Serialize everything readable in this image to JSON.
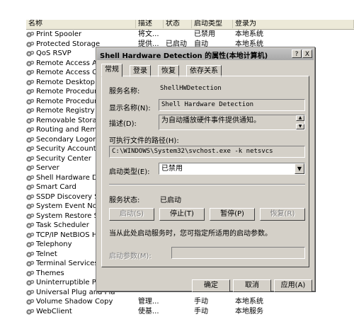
{
  "list": {
    "columns": [
      "名称",
      "描述",
      "状态",
      "启动类型",
      "登录为"
    ],
    "rows": [
      {
        "name": "Print Spooler",
        "desc": "将文...",
        "status": "",
        "startup": "已禁用",
        "logon": "本地系统"
      },
      {
        "name": "Protected Storage",
        "desc": "提供...",
        "status": "已启动",
        "startup": "自动",
        "logon": "本地系统"
      },
      {
        "name": "QoS RSVP",
        "desc": "",
        "status": "",
        "startup": "",
        "logon": ""
      },
      {
        "name": "Remote Access Auto C",
        "desc": "",
        "status": "",
        "startup": "",
        "logon": ""
      },
      {
        "name": "Remote Access Conne",
        "desc": "",
        "status": "",
        "startup": "",
        "logon": ""
      },
      {
        "name": "Remote Desktop Help",
        "desc": "",
        "status": "",
        "startup": "",
        "logon": ""
      },
      {
        "name": "Remote Procedure Ca",
        "desc": "",
        "status": "",
        "startup": "",
        "logon": ""
      },
      {
        "name": "Remote Procedure Ca",
        "desc": "",
        "status": "",
        "startup": "",
        "logon": ""
      },
      {
        "name": "Remote Registry",
        "desc": "",
        "status": "",
        "startup": "",
        "logon": ""
      },
      {
        "name": "Removable Storage",
        "desc": "",
        "status": "",
        "startup": "",
        "logon": ""
      },
      {
        "name": "Routing and Remote A",
        "desc": "",
        "status": "",
        "startup": "",
        "logon": ""
      },
      {
        "name": "Secondary Logon",
        "desc": "",
        "status": "",
        "startup": "",
        "logon": ""
      },
      {
        "name": "Security Accounts Mar",
        "desc": "",
        "status": "",
        "startup": "",
        "logon": ""
      },
      {
        "name": "Security Center",
        "desc": "",
        "status": "",
        "startup": "",
        "logon": ""
      },
      {
        "name": "Server",
        "desc": "",
        "status": "",
        "startup": "",
        "logon": ""
      },
      {
        "name": "Shell Hardware Detect",
        "desc": "",
        "status": "",
        "startup": "",
        "logon": ""
      },
      {
        "name": "Smart Card",
        "desc": "",
        "status": "",
        "startup": "",
        "logon": ""
      },
      {
        "name": "SSDP Discovery Servi",
        "desc": "",
        "status": "",
        "startup": "",
        "logon": ""
      },
      {
        "name": "System Event Notifica",
        "desc": "",
        "status": "",
        "startup": "",
        "logon": ""
      },
      {
        "name": "System Restore Servic",
        "desc": "",
        "status": "",
        "startup": "",
        "logon": ""
      },
      {
        "name": "Task Scheduler",
        "desc": "",
        "status": "",
        "startup": "",
        "logon": ""
      },
      {
        "name": "TCP/IP NetBIOS Helpe",
        "desc": "",
        "status": "",
        "startup": "",
        "logon": ""
      },
      {
        "name": "Telephony",
        "desc": "",
        "status": "",
        "startup": "",
        "logon": ""
      },
      {
        "name": "Telnet",
        "desc": "",
        "status": "",
        "startup": "",
        "logon": ""
      },
      {
        "name": "Terminal Services",
        "desc": "",
        "status": "",
        "startup": "",
        "logon": ""
      },
      {
        "name": "Themes",
        "desc": "",
        "status": "",
        "startup": "",
        "logon": ""
      },
      {
        "name": "Uninterruptible Power",
        "desc": "",
        "status": "",
        "startup": "",
        "logon": ""
      },
      {
        "name": "Universal Plug and Pla",
        "desc": "",
        "status": "",
        "startup": "",
        "logon": ""
      },
      {
        "name": "Volume Shadow Copy",
        "desc": "管理...",
        "status": "",
        "startup": "手动",
        "logon": "本地系统"
      },
      {
        "name": "WebClient",
        "desc": "使基...",
        "status": "",
        "startup": "手动",
        "logon": "本地服务"
      }
    ]
  },
  "dialog": {
    "title": "Shell Hardware Detection 的属性(本地计算机)",
    "help_label": "?",
    "close_label": "X",
    "tabs": [
      "常规",
      "登录",
      "恢复",
      "依存关系"
    ],
    "service_name_label": "服务名称:",
    "service_name": "ShellHWDetection",
    "display_name_label": "显示名称(N):",
    "display_name": "Shell Hardware Detection",
    "description_label": "描述(D):",
    "description": "为自动播放硬件事件提供通知。",
    "exe_path_label": "可执行文件的路径(H):",
    "exe_path": "C:\\WINDOWS\\System32\\svchost.exe -k netsvcs",
    "startup_type_label": "启动类型(E):",
    "startup_type": "已禁用",
    "service_status_label": "服务状态:",
    "service_status": "已启动",
    "start_button": "启动(S)",
    "stop_button": "停止(T)",
    "pause_button": "暂停(P)",
    "resume_button": "恢复(R)",
    "start_params_hint": "当从此处启动服务时，您可指定所适用的启动参数。",
    "start_params_label": "启动参数(M):",
    "start_params_value": "",
    "ok_button": "确定",
    "cancel_button": "取消",
    "apply_button": "应用(A)"
  },
  "colors": {
    "dialog_bg": "#d4d0c8",
    "title_bg": "#b4b4b4"
  }
}
